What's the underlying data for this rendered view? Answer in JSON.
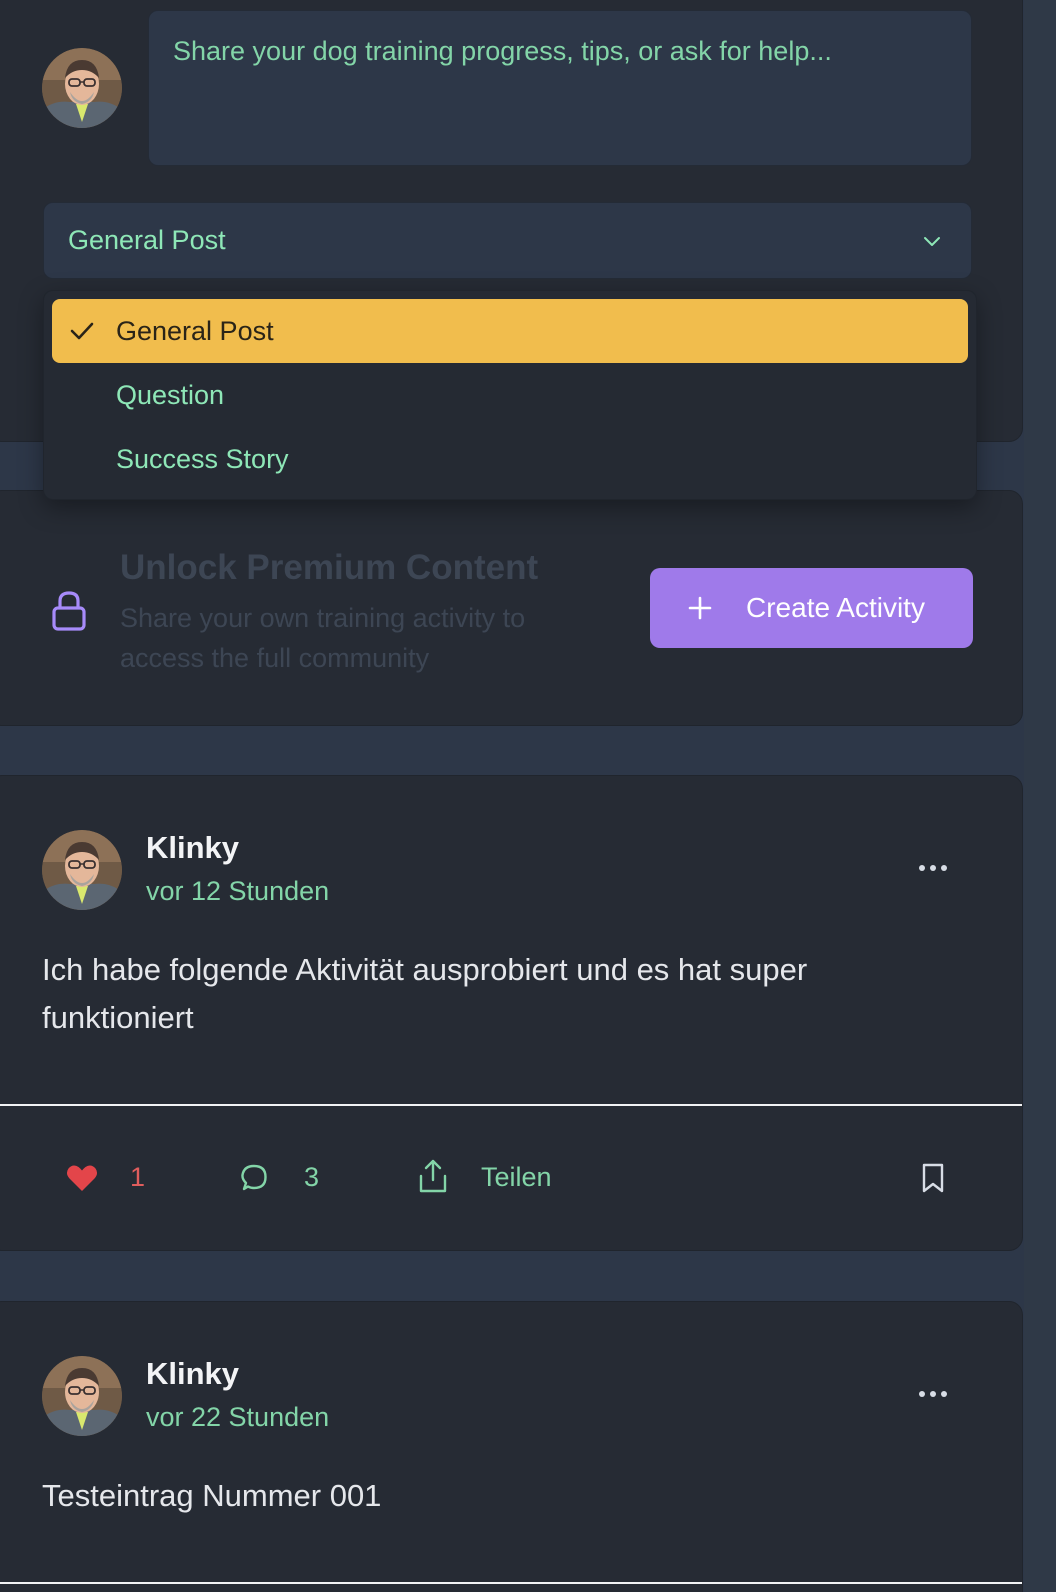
{
  "composer": {
    "placeholder": "Share your dog training progress, tips, or ask for help...",
    "select_value": "General Post"
  },
  "dropdown": {
    "options": [
      "General Post",
      "Question",
      "Success Story"
    ],
    "selected_index": 0
  },
  "premium": {
    "title": "Unlock Premium Content",
    "description": "Share your own training activity to access the full community",
    "button_label": "Create Activity"
  },
  "posts": [
    {
      "author": "Klinky",
      "time": "vor 12 Stunden",
      "text": "Ich habe folgende Aktivität ausprobiert und es hat super funktioniert",
      "likes": "1",
      "comments": "3",
      "share_label": "Teilen"
    },
    {
      "author": "Klinky",
      "time": "vor 22 Stunden",
      "text": "Testeintrag Nummer 001"
    }
  ],
  "colors": {
    "background": "#2d3748",
    "card": "#262b34",
    "accent_green": "#83d5a8",
    "selected_option": "#f1bd4d",
    "primary_button": "#9f7aea",
    "like_red": "#e05d5d"
  },
  "icons": [
    "user-avatar",
    "chevron-down-icon",
    "check-icon",
    "lock-icon",
    "plus-icon",
    "more-icon",
    "heart-icon",
    "comment-icon",
    "share-icon",
    "bookmark-icon"
  ]
}
